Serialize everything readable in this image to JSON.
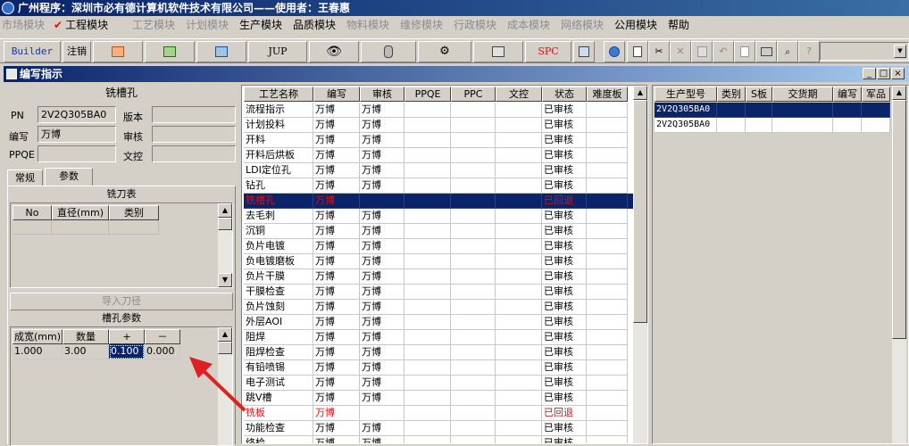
{
  "window": {
    "title": "广州程序：深圳市必有德计算机软件技术有限公司——使用者：王春惠"
  },
  "menu": [
    {
      "label": "市场模块",
      "enabled": false
    },
    {
      "label": "工程模块",
      "enabled": true,
      "checked": true
    },
    {
      "label": "工艺模块",
      "enabled": false
    },
    {
      "label": "计划模块",
      "enabled": false
    },
    {
      "label": "生产模块",
      "enabled": true
    },
    {
      "label": "品质模块",
      "enabled": true
    },
    {
      "label": "物料模块",
      "enabled": false
    },
    {
      "label": "维修模块",
      "enabled": false
    },
    {
      "label": "行政模块",
      "enabled": false
    },
    {
      "label": "成本模块",
      "enabled": false
    },
    {
      "label": "网络模块",
      "enabled": false
    },
    {
      "label": "公用模块",
      "enabled": true
    },
    {
      "label": "帮助",
      "enabled": true
    }
  ],
  "toolbar": {
    "builder_label": "Builder",
    "logout_label": "注销",
    "jup_label": "JUP",
    "spc_label": "SPC"
  },
  "child_window": {
    "title": "编写指示"
  },
  "left": {
    "heading": "铣槽孔",
    "pn_label": "PN",
    "pn_value": "2V2Q305BA0",
    "version_label": "版本",
    "version_value": "",
    "author_label": "编写",
    "author_value": "万博",
    "review_label": "审核",
    "review_value": "",
    "ppqe_label": "PPQE",
    "ppqe_value": "",
    "doc_control_label": "文控",
    "doc_control_value": "",
    "tabs": [
      "常规",
      "参数"
    ],
    "cutter_table_title": "铣刀表",
    "cutter_columns": [
      "No",
      "直径(mm)",
      "类别"
    ],
    "import_button": "导入刀径",
    "slot_params_title": "槽孔参数",
    "slot_columns": [
      "成宽(mm)",
      "数量",
      "+",
      "－"
    ],
    "slot_row": [
      "1.000",
      "3.00",
      "0.100",
      "0.000"
    ]
  },
  "process": {
    "columns": [
      "工艺名称",
      "编写",
      "审核",
      "PPQE",
      "PPC",
      "文控",
      "状态",
      "难度板"
    ],
    "rows": [
      [
        "流程指示",
        "万博",
        "万博",
        "",
        "",
        "",
        "已审核",
        ""
      ],
      [
        "计划投料",
        "万博",
        "万博",
        "",
        "",
        "",
        "已审核",
        ""
      ],
      [
        "开料",
        "万博",
        "万博",
        "",
        "",
        "",
        "已审核",
        ""
      ],
      [
        "开料后烘板",
        "万博",
        "万博",
        "",
        "",
        "",
        "已审核",
        ""
      ],
      [
        "LDI定位孔",
        "万博",
        "万博",
        "",
        "",
        "",
        "已审核",
        ""
      ],
      [
        "钻孔",
        "万博",
        "万博",
        "",
        "",
        "",
        "已审核",
        ""
      ],
      [
        "铣槽孔",
        "万博",
        "",
        "",
        "",
        "",
        "已回退",
        ""
      ],
      [
        "去毛刺",
        "万博",
        "万博",
        "",
        "",
        "",
        "已审核",
        ""
      ],
      [
        "沉铜",
        "万博",
        "万博",
        "",
        "",
        "",
        "已审核",
        ""
      ],
      [
        "负片电镀",
        "万博",
        "万博",
        "",
        "",
        "",
        "已审核",
        ""
      ],
      [
        "负电镀磨板",
        "万博",
        "万博",
        "",
        "",
        "",
        "已审核",
        ""
      ],
      [
        "负片干膜",
        "万博",
        "万博",
        "",
        "",
        "",
        "已审核",
        ""
      ],
      [
        "干膜检查",
        "万博",
        "万博",
        "",
        "",
        "",
        "已审核",
        ""
      ],
      [
        "负片蚀刻",
        "万博",
        "万博",
        "",
        "",
        "",
        "已审核",
        ""
      ],
      [
        "外层AOI",
        "万博",
        "万博",
        "",
        "",
        "",
        "已审核",
        ""
      ],
      [
        "阻焊",
        "万博",
        "万博",
        "",
        "",
        "",
        "已审核",
        ""
      ],
      [
        "阻焊检查",
        "万博",
        "万博",
        "",
        "",
        "",
        "已审核",
        ""
      ],
      [
        "有铅喷锡",
        "万博",
        "万博",
        "",
        "",
        "",
        "已审核",
        ""
      ],
      [
        "电子测试",
        "万博",
        "万博",
        "",
        "",
        "",
        "已审核",
        ""
      ],
      [
        "跳V槽",
        "万博",
        "万博",
        "",
        "",
        "",
        "已审核",
        ""
      ],
      [
        "铣板",
        "万博",
        "",
        "",
        "",
        "",
        "已回退",
        ""
      ],
      [
        "功能检查",
        "万博",
        "万博",
        "",
        "",
        "",
        "已审核",
        ""
      ],
      [
        "终检",
        "万博",
        "万博",
        "",
        "",
        "",
        "已审核",
        ""
      ]
    ],
    "selected_index": 6,
    "red_indices": [
      6,
      20
    ]
  },
  "product": {
    "columns": [
      "生产型号",
      "类别",
      "S板",
      "交货期",
      "编写",
      "军品"
    ],
    "rows": [
      [
        "2V2Q305BA0",
        "",
        "",
        "",
        "",
        ""
      ],
      [
        "2V2Q305BA0",
        "",
        "",
        "",
        "",
        ""
      ]
    ],
    "selected_index": 0
  },
  "colors": {
    "title_blue": "#0a246a",
    "selection": "#0a246a",
    "rollback_red": "#e01010",
    "annotation_arrow": "#e02020"
  },
  "icons": [
    "app-icon",
    "check-icon",
    "powerpoint-icon",
    "excel-icon",
    "word-icon",
    "eye-icon",
    "database-icon",
    "gears-icon",
    "printer-setup-icon",
    "ie-icon",
    "new-document-icon",
    "cut-icon",
    "delete-icon",
    "save-icon",
    "undo-icon",
    "print-preview-icon",
    "print-icon",
    "find-icon",
    "help-icon"
  ]
}
